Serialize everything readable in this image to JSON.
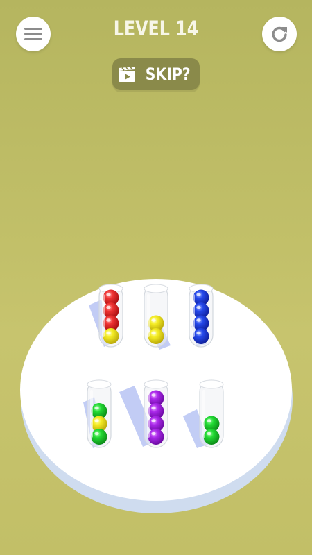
{
  "header": {
    "level_label": "LEVEL 14",
    "skip_label": "SKIP?",
    "menu_icon": "hamburger-menu-icon",
    "restart_icon": "restart-icon",
    "skip_icon": "video-clapper-icon"
  },
  "colors": {
    "background": "#c2c069",
    "board": "#ffffff",
    "skip_button": "#8a8a4a",
    "red": "#e8262a",
    "yellow": "#f2e91b",
    "blue": "#1f3fe0",
    "purple": "#a31fe3",
    "green": "#1fd52e"
  },
  "tubes": [
    {
      "id": "tube-1",
      "balls": [
        "red",
        "red",
        "red",
        "yellow"
      ]
    },
    {
      "id": "tube-2",
      "balls": [
        "yellow",
        "yellow"
      ]
    },
    {
      "id": "tube-3",
      "balls": [
        "blue",
        "blue",
        "blue",
        "blue"
      ]
    },
    {
      "id": "tube-4",
      "balls": [
        "green",
        "yellow",
        "green"
      ]
    },
    {
      "id": "tube-5",
      "balls": [
        "purple",
        "purple",
        "purple",
        "purple"
      ]
    },
    {
      "id": "tube-6",
      "balls": [
        "green",
        "green"
      ]
    }
  ]
}
